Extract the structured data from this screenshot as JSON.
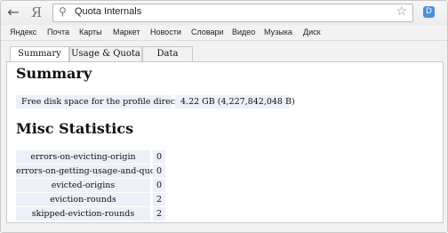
{
  "browser": {
    "back_icon": "arrow-left",
    "yandex_logo": "Я",
    "url": "Quota Internals",
    "star_icon": "star",
    "extension_icon": "D"
  },
  "bookmarks": [
    "Яндекс",
    "Почта",
    "Карты",
    "Маркет",
    "Новости",
    "Словари",
    "Видео",
    "Музыка",
    "Диск"
  ],
  "tabs": [
    {
      "label": "Summary",
      "active": true
    },
    {
      "label": "Usage & Quota",
      "active": false
    },
    {
      "label": "Data",
      "active": false
    }
  ],
  "summary": {
    "heading": "Summary",
    "label": "Free disk space for the profile directory.",
    "value": "4.22 GB (4,227,842,048 B)"
  },
  "misc": {
    "heading": "Misc Statistics",
    "rows": [
      {
        "name": "errors-on-evicting-origin",
        "value": "0"
      },
      {
        "name": "errors-on-getting-usage-and-quota",
        "value": "0"
      },
      {
        "name": "evicted-origins",
        "value": "0"
      },
      {
        "name": "eviction-rounds",
        "value": "2"
      },
      {
        "name": "skipped-eviction-rounds",
        "value": "2"
      }
    ]
  }
}
